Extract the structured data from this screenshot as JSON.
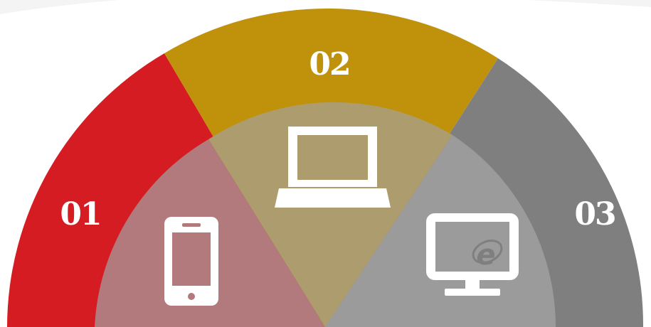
{
  "segments": [
    {
      "number": "01",
      "color": "#d41c22",
      "inner_color": "#b27a7c",
      "icon": "smartphone-icon"
    },
    {
      "number": "02",
      "color": "#c0920b",
      "inner_color": "#ad9d6e",
      "icon": "laptop-icon"
    },
    {
      "number": "03",
      "color": "#7f7f7f",
      "inner_color": "#9b9b9b",
      "icon": "desktop-ie-icon"
    }
  ],
  "icon_color": "#ffffff",
  "background_color": "#ffffff"
}
